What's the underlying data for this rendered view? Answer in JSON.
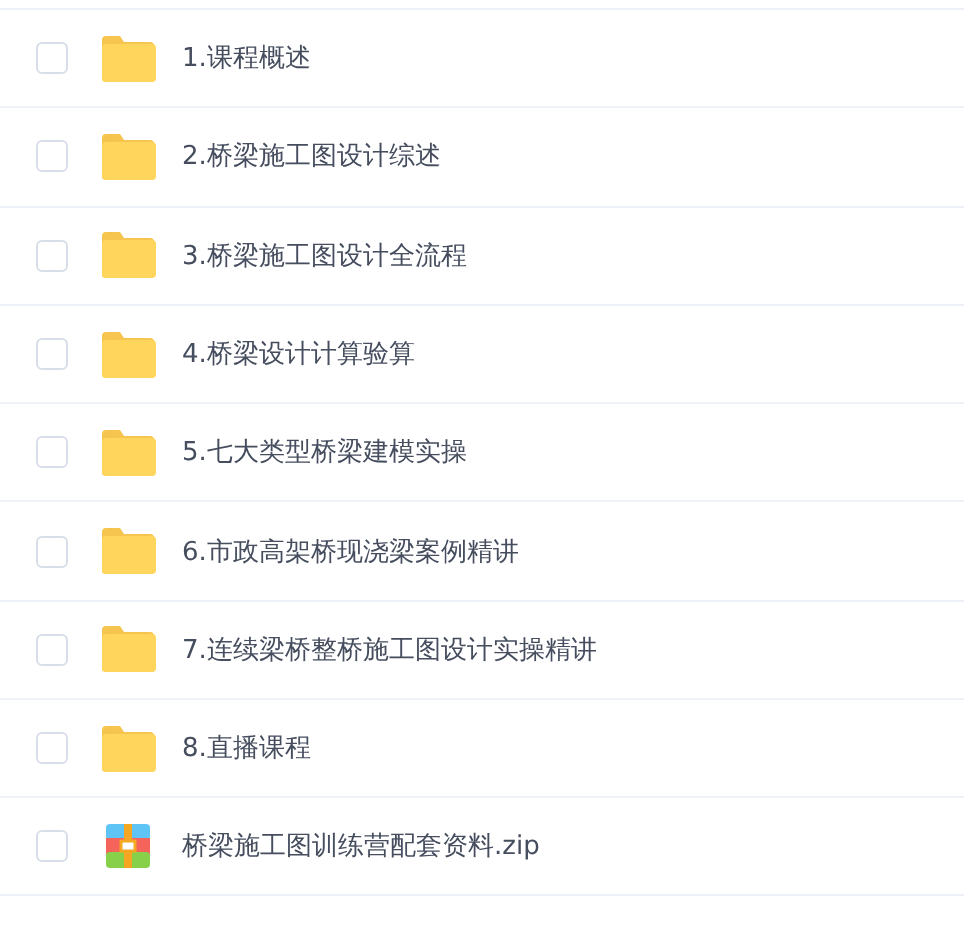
{
  "files": [
    {
      "kind": "folder",
      "name": "1.课程概述",
      "checked": false
    },
    {
      "kind": "folder",
      "name": "2.桥梁施工图设计综述",
      "checked": false
    },
    {
      "kind": "folder",
      "name": "3.桥梁施工图设计全流程",
      "checked": false
    },
    {
      "kind": "folder",
      "name": "4.桥梁设计计算验算",
      "checked": false
    },
    {
      "kind": "folder",
      "name": "5.七大类型桥梁建模实操",
      "checked": false
    },
    {
      "kind": "folder",
      "name": "6.市政高架桥现浇梁案例精讲",
      "checked": false
    },
    {
      "kind": "folder",
      "name": "7.连续梁桥整桥施工图设计实操精讲",
      "checked": false
    },
    {
      "kind": "folder",
      "name": "8.直播课程",
      "checked": false
    },
    {
      "kind": "archive",
      "name": "桥梁施工图训练营配套资料.zip",
      "checked": false
    }
  ]
}
